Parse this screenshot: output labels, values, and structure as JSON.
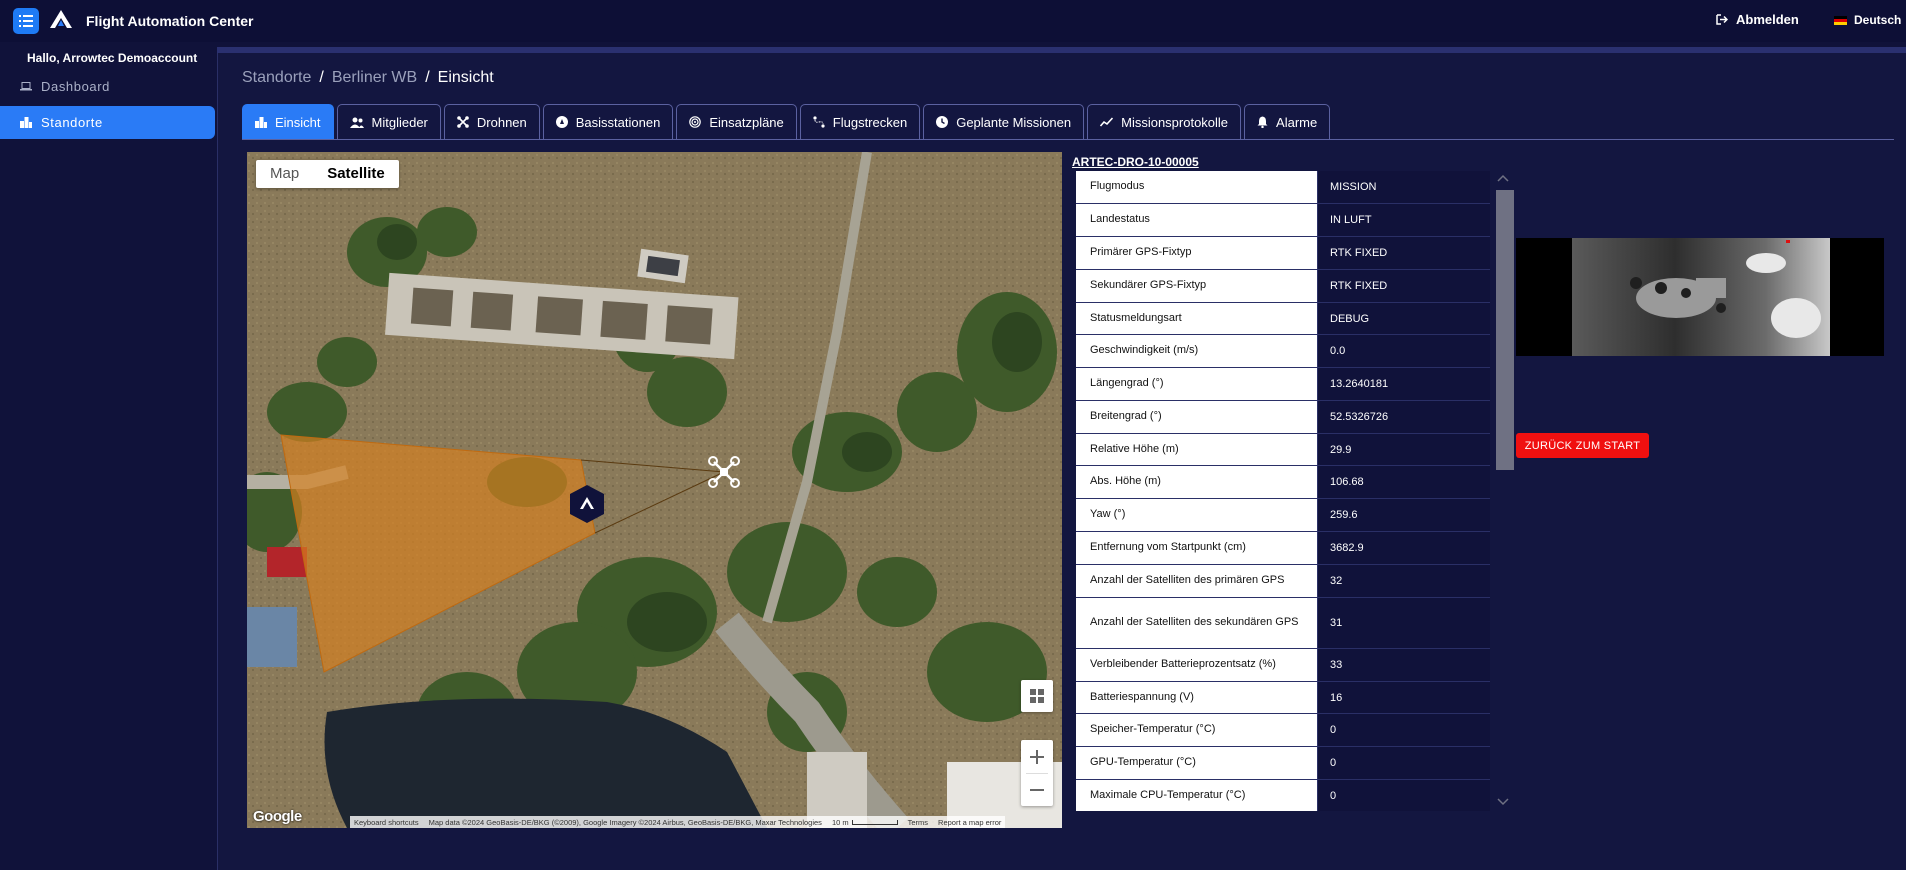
{
  "app": {
    "title": "Flight Automation Center",
    "logout_label": "Abmelden",
    "language_label": "Deutsch"
  },
  "sidebar": {
    "greeting": "Hallo, Arrowtec Demoaccount",
    "items": [
      {
        "label": "Dashboard",
        "icon": "laptop-icon",
        "active": false
      },
      {
        "label": "Standorte",
        "icon": "buildings-icon",
        "active": true
      }
    ]
  },
  "breadcrumb": [
    "Standorte",
    "Berliner WB",
    "Einsicht"
  ],
  "tabs": [
    {
      "label": "Einsicht",
      "icon": "buildings-icon",
      "active": true
    },
    {
      "label": "Mitglieder",
      "icon": "users-icon",
      "active": false
    },
    {
      "label": "Drohnen",
      "icon": "drone-icon",
      "active": false
    },
    {
      "label": "Basisstationen",
      "icon": "base-station-icon",
      "active": false
    },
    {
      "label": "Einsatzpläne",
      "icon": "target-icon",
      "active": false
    },
    {
      "label": "Flugstrecken",
      "icon": "route-icon",
      "active": false
    },
    {
      "label": "Geplante Missionen",
      "icon": "mission-icon",
      "active": false
    },
    {
      "label": "Missionsprotokolle",
      "icon": "chart-line-icon",
      "active": false
    },
    {
      "label": "Alarme",
      "icon": "bell-icon",
      "active": false
    }
  ],
  "map": {
    "type_map_label": "Map",
    "type_satellite_label": "Satellite",
    "selected_type": "Satellite",
    "google_label": "Google",
    "footer": {
      "shortcuts": "Keyboard shortcuts",
      "attribution": "Map data ©2024 GeoBasis-DE/BKG (©2009), Google Imagery ©2024 Airbus, GeoBasis-DE/BKG, Maxar Technologies",
      "scale": "10 m",
      "terms": "Terms",
      "report": "Report a map error"
    },
    "fov_color": "#d7801f"
  },
  "drone": {
    "id": "ARTEC-DRO-10-00005",
    "telemetry": [
      {
        "label": "Flugmodus",
        "value": "MISSION"
      },
      {
        "label": "Landestatus",
        "value": "IN LUFT"
      },
      {
        "label": "Primärer GPS-Fixtyp",
        "value": "RTK FIXED"
      },
      {
        "label": "Sekundärer GPS-Fixtyp",
        "value": "RTK FIXED"
      },
      {
        "label": "Statusmeldungsart",
        "value": "DEBUG"
      },
      {
        "label": "Geschwindigkeit (m/s)",
        "value": "0.0"
      },
      {
        "label": "Längengrad (°)",
        "value": "13.2640181"
      },
      {
        "label": "Breitengrad (°)",
        "value": "52.5326726"
      },
      {
        "label": "Relative Höhe (m)",
        "value": "29.9"
      },
      {
        "label": "Abs. Höhe (m)",
        "value": "106.68"
      },
      {
        "label": "Yaw (°)",
        "value": "259.6"
      },
      {
        "label": "Entfernung vom Startpunkt (cm)",
        "value": "3682.9"
      },
      {
        "label": "Anzahl der Satelliten des primären GPS",
        "value": "32"
      },
      {
        "label": "Anzahl der Satelliten des sekundären GPS",
        "value": "31"
      },
      {
        "label": "Verbleibender Batterieprozentsatz (%)",
        "value": "33"
      },
      {
        "label": "Batteriespannung (V)",
        "value": "16"
      },
      {
        "label": "Speicher-Temperatur (°C)",
        "value": "0"
      },
      {
        "label": "GPU-Temperatur (°C)",
        "value": "0"
      },
      {
        "label": "Maximale CPU-Temperatur (°C)",
        "value": "0"
      }
    ],
    "return_button_label": "ZURÜCK ZUM START"
  },
  "colors": {
    "accent": "#2a7bf6",
    "background": "#10123a",
    "danger": "#f01010"
  }
}
